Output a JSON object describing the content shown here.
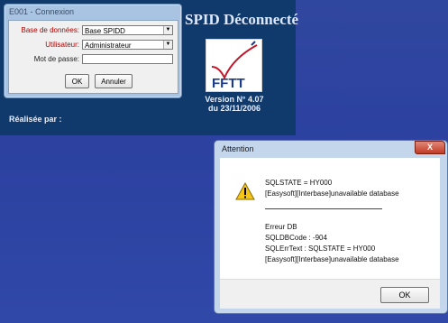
{
  "splash": {
    "title": "SPID Déconnecté",
    "logo_text": "FFTT",
    "version_line1": "Version N° 4.07",
    "version_line2": "du 23/11/2006",
    "credits": "Réalisée par :"
  },
  "login": {
    "title": "E001 - Connexion",
    "database_label": "Base de données:",
    "database_value": "Base SPIDD",
    "user_label": "Utilisateur:",
    "user_value": "Administrateur",
    "password_label": "Mot de passe:",
    "password_value": "",
    "ok_label": "OK",
    "cancel_label": "Annuler"
  },
  "dialog": {
    "title": "Attention",
    "close_label": "X",
    "line1": "SQLSTATE = HY000",
    "line2": "[Easysoft][Interbase]unavailable database",
    "line3": "Erreur DB",
    "line4": "SQLDBCode : -904",
    "line5": "SQLErrText : SQLSTATE = HY000",
    "line6": "[Easysoft][Interbase]unavailable database",
    "ok_label": "OK"
  },
  "colors": {
    "desktop": "#2c41a0",
    "splash": "#103a6c",
    "close_button": "#c23a24",
    "required_label": "#b00000"
  }
}
